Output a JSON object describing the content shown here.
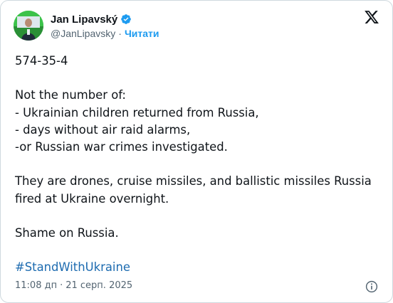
{
  "author": {
    "name": "Jan Lipavský",
    "handle": "@JanLipavsky",
    "separator": "·",
    "follow_label": "Читати",
    "verified_icon": "verified-badge-icon",
    "accent_color": "#1d9bf0"
  },
  "brand_icon": "x-logo-icon",
  "tweet": {
    "line_number": "574-35-4",
    "not_heading": "Not the number of:",
    "list": [
      "- Ukrainian children returned from Russia,",
      "- days without air raid alarms,",
      "-or Russian war crimes investigated."
    ],
    "explanation": "They are drones, cruise missiles, and ballistic missiles Russia fired at Ukraine overnight.",
    "closing": "Shame on Russia.",
    "hashtag": "#StandWithUkraine"
  },
  "meta": {
    "time": "11:08 дп",
    "separator": "·",
    "date": "21 серп. 2025"
  },
  "info_icon": "info-icon"
}
